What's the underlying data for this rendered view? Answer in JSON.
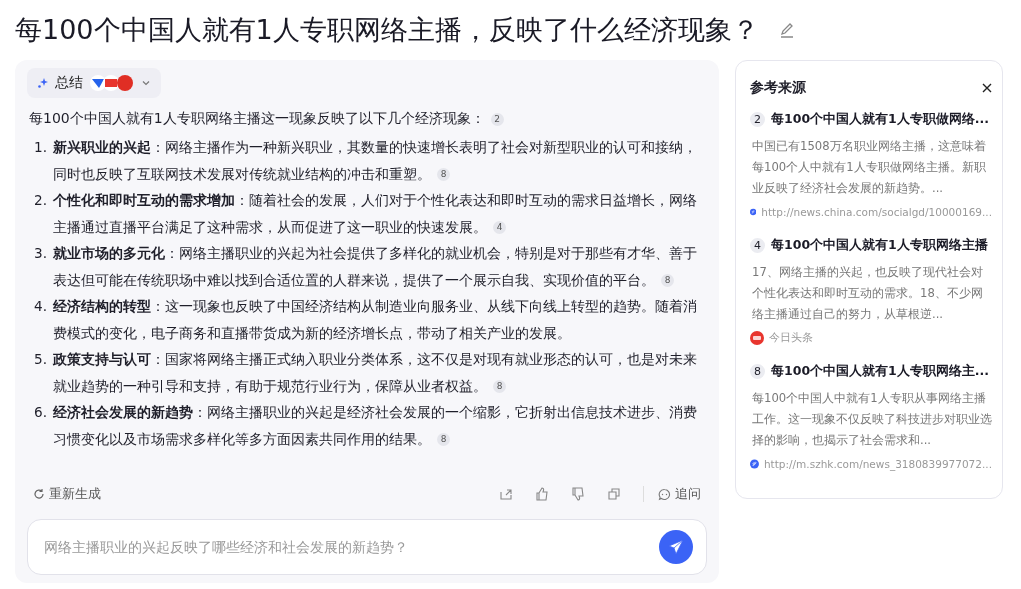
{
  "title": "每100个中国人就有1人专职网络主播，反映了什么经济现象？",
  "summary_tab": {
    "label": "总结"
  },
  "intro": {
    "text": "每100个中国人就有1人专职网络主播这一现象反映了以下几个经济现象：",
    "cite": "2"
  },
  "points": [
    {
      "number": "1.",
      "text": "**新兴职业的兴起**：网络主播作为一种新兴职业，其数量的快速增长表明了社会对新型职业的认可和接纳，同时也反映了互联网技术发展对传统就业结构的冲击和重塑。",
      "cite": "8"
    },
    {
      "number": "2.",
      "text": "**个性化和即时互动的需求增加**：随着社会的发展，人们对于个性化表达和即时互动的需求日益增长，网络主播通过直播平台满足了这种需求，从而促进了这一职业的快速发展。",
      "cite": "4"
    },
    {
      "number": "3.",
      "text": "**就业市场的多元化**：网络主播职业的兴起为社会提供了多样化的就业机会，特别是对于那些有才华、善于表达但可能在传统职场中难以找到合适位置的人群来说，提供了一个展示自我、实现价值的平台。",
      "cite": "8"
    },
    {
      "number": "4.",
      "text": "**经济结构的转型**：这一现象也反映了中国经济结构从制造业向服务业、从线下向线上转型的趋势。随着消费模式的变化，电子商务和直播带货成为新的经济增长点，带动了相关产业的发展。"
    },
    {
      "number": "5.",
      "text": "**政策支持与认可**：国家将网络主播正式纳入职业分类体系，这不仅是对现有就业形态的认可，也是对未来就业趋势的一种引导和支持，有助于规范行业行为，保障从业者权益。",
      "cite": "8"
    },
    {
      "number": "6.",
      "text": "**经济社会发展的新趋势**：网络主播职业的兴起是经济社会发展的一个缩影，它折射出信息技术进步、消费习惯变化以及市场需求多样化等多方面因素共同作用的结果。",
      "cite": "8"
    }
  ],
  "actions": {
    "regenerate": "重新生成",
    "follow_up": "追问"
  },
  "input": {
    "placeholder": "网络主播职业的兴起反映了哪些经济和社会发展的新趋势？"
  },
  "sources_panel": {
    "title": "参考来源",
    "sources": [
      {
        "index": "2",
        "title": "每100个中国人就有1人专职做网络...",
        "snippet": "中国已有1508万名职业网络主播，这意味着每100个人中就有1人专职做网络主播。新职业反映了经济社会发展的新趋势。...",
        "kind": "link",
        "origin": "http://news.china.com/socialgd/10000169..."
      },
      {
        "index": "4",
        "title": "每100个中国人就有1人专职网络主播",
        "snippet": "17、网络主播的兴起，也反映了现代社会对个性化表达和即时互动的需求。18、不少网络主播通过自己的努力，从草根逆...",
        "kind": "news",
        "origin": "今日头条"
      },
      {
        "index": "8",
        "title": "每100个中国人就有1人专职网络主...",
        "snippet": "每100个中国人中就有1人专职从事网络主播工作。这一现象不仅反映了科技进步对职业选择的影响，也揭示了社会需求和...",
        "kind": "link",
        "origin": "http://m.szhk.com/news_3180839977072..."
      }
    ]
  }
}
